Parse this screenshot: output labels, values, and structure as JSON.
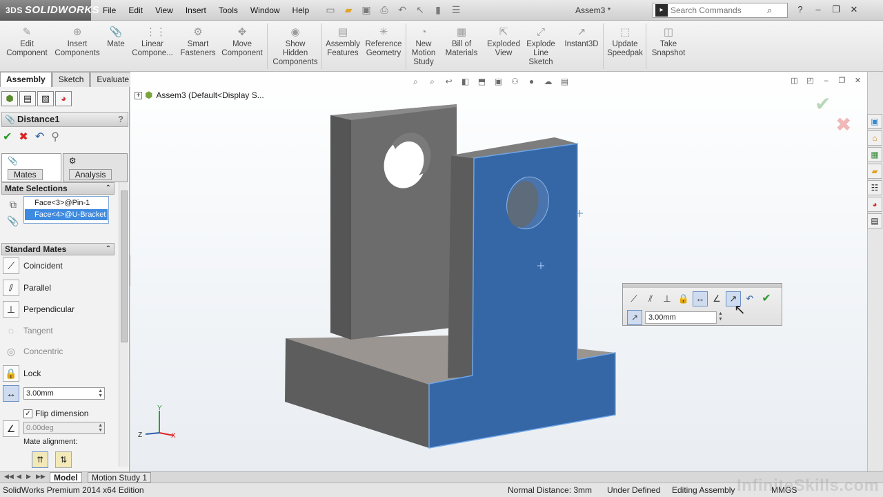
{
  "app": {
    "logo_prefix": "3DS",
    "logo": "SOLIDWORKS",
    "document_title": "Assem3 *",
    "menus": [
      "File",
      "Edit",
      "View",
      "Insert",
      "Tools",
      "Window",
      "Help"
    ],
    "search_placeholder": "Search Commands"
  },
  "command_manager": {
    "commands": [
      {
        "label": "Edit\nComponent",
        "icon": "edit-component-icon"
      },
      {
        "label": "Insert\nComponents",
        "icon": "insert-components-icon"
      },
      {
        "label": "Mate",
        "icon": "mate-icon"
      },
      {
        "label": "Linear\nCompone...",
        "icon": "linear-pattern-icon"
      },
      {
        "label": "Smart\nFasteners",
        "icon": "smart-fasteners-icon"
      },
      {
        "label": "Move\nComponent",
        "icon": "move-component-icon"
      },
      {
        "label": "Show\nHidden\nComponents",
        "icon": "show-hidden-icon"
      },
      {
        "label": "Assembly\nFeatures",
        "icon": "assembly-features-icon"
      },
      {
        "label": "Reference\nGeometry",
        "icon": "reference-geometry-icon"
      },
      {
        "label": "New\nMotion\nStudy",
        "icon": "motion-study-icon"
      },
      {
        "label": "Bill of\nMaterials",
        "icon": "bom-icon"
      },
      {
        "label": "Exploded\nView",
        "icon": "exploded-view-icon"
      },
      {
        "label": "Explode\nLine\nSketch",
        "icon": "explode-line-icon"
      },
      {
        "label": "Instant3D",
        "icon": "instant3d-icon"
      },
      {
        "label": "Update\nSpeedpak",
        "icon": "speedpak-icon"
      },
      {
        "label": "Take\nSnapshot",
        "icon": "snapshot-icon"
      }
    ],
    "tabs": [
      {
        "label": "Assembly",
        "active": true
      },
      {
        "label": "Sketch",
        "active": false
      },
      {
        "label": "Evaluate",
        "active": false
      }
    ]
  },
  "property_manager": {
    "title": "Distance1",
    "help": "?",
    "sub_tabs": [
      {
        "label": "Mates",
        "active": true
      },
      {
        "label": "Analysis",
        "active": false
      }
    ],
    "mate_selections": {
      "header": "Mate Selections",
      "items": [
        "Face<3>@Pin-1",
        "Face<4>@U-Bracket"
      ]
    },
    "standard_mates": {
      "header": "Standard Mates",
      "items": [
        {
          "label": "Coincident",
          "icon": "coincident-icon",
          "enabled": true
        },
        {
          "label": "Parallel",
          "icon": "parallel-icon",
          "enabled": true
        },
        {
          "label": "Perpendicular",
          "icon": "perpendicular-icon",
          "enabled": true
        },
        {
          "label": "Tangent",
          "icon": "tangent-icon",
          "enabled": false
        },
        {
          "label": "Concentric",
          "icon": "concentric-icon",
          "enabled": false
        },
        {
          "label": "Lock",
          "icon": "lock-icon",
          "enabled": true
        }
      ],
      "distance_value": "3.00mm",
      "flip_dimension_label": "Flip dimension",
      "flip_dimension_checked": true,
      "angle_value": "0.00deg",
      "mate_alignment_label": "Mate alignment:"
    }
  },
  "viewport": {
    "tree_node": "Assem3  (Default<Display S..."
  },
  "mate_popup": {
    "distance_value": "3.00mm"
  },
  "triad": {
    "x": "X",
    "y": "Y",
    "z": "Z"
  },
  "bottom_tabs": [
    {
      "label": "Model",
      "active": true
    },
    {
      "label": "Motion Study 1",
      "active": false
    }
  ],
  "status": {
    "edition": "SolidWorks Premium 2014 x64 Edition",
    "measure": "Normal Distance: 3mm",
    "state": "Under Defined",
    "mode": "Editing Assembly",
    "units": "MMGS"
  },
  "watermark": "InfiniteSkills.com",
  "colors": {
    "selected_face": "#3567a7",
    "part_gray": "#6b6b6b",
    "accept_green": "#2a9a2a",
    "cancel_red": "#dd2222"
  }
}
